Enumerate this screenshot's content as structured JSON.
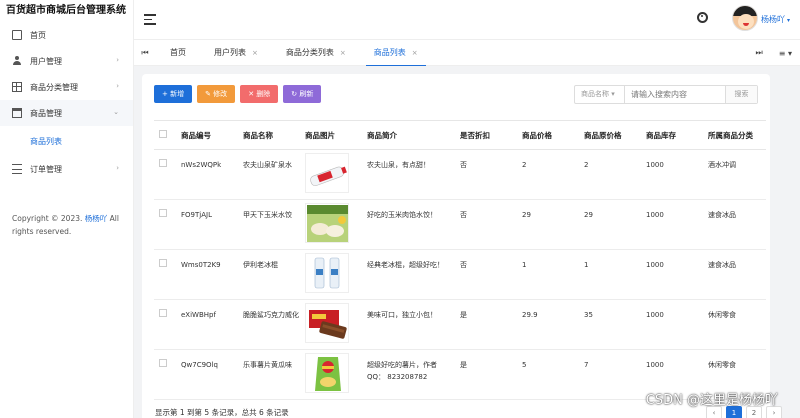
{
  "app": {
    "title": "百货超市商城后台管理系统"
  },
  "sidebar": {
    "items": [
      {
        "label": "首页",
        "icon": "home-icon"
      },
      {
        "label": "用户管理",
        "icon": "user-icon"
      },
      {
        "label": "商品分类管理",
        "icon": "grid-icon"
      },
      {
        "label": "商品管理",
        "icon": "shop-icon"
      },
      {
        "label": "商品列表"
      },
      {
        "label": "订单管理",
        "icon": "list-icon"
      }
    ],
    "copyright_prefix": "Copyright © 2023.",
    "copyright_name": "杨杨吖",
    "copyright_suffix": "All rights reserved."
  },
  "header": {
    "username": "杨杨吖"
  },
  "tabs": [
    {
      "label": "首页"
    },
    {
      "label": "用户列表"
    },
    {
      "label": "商品分类列表"
    },
    {
      "label": "商品列表"
    }
  ],
  "toolbar": {
    "add_label": "+ 新增",
    "edit_label": "✎ 修改",
    "delete_label": "✕ 删除",
    "refresh_label": "↻ 刷新"
  },
  "search": {
    "field_label": "商品名称",
    "placeholder": "请输入搜索内容",
    "button_label": "搜索"
  },
  "table": {
    "columns": [
      "商品编号",
      "商品名称",
      "商品图片",
      "商品简介",
      "是否折扣",
      "商品价格",
      "商品原价格",
      "商品库存",
      "所属商品分类"
    ],
    "rows": [
      {
        "code": "nWs2WQPk",
        "name": "农夫山泉矿泉水",
        "intro": "农夫山泉，有点甜！",
        "discount": "否",
        "price": "2",
        "original": "2",
        "stock": "1000",
        "category": "酒水冲调"
      },
      {
        "code": "FO9TjAJL",
        "name": "甲天下玉米水饺",
        "intro": "好吃的玉米肉馅水饺！",
        "discount": "否",
        "price": "29",
        "original": "29",
        "stock": "1000",
        "category": "速食冰品"
      },
      {
        "code": "Wms0T2K9",
        "name": "伊利老冰棍",
        "intro": "经典老冰棍，超级好吃！",
        "discount": "否",
        "price": "1",
        "original": "1",
        "stock": "1000",
        "category": "速食冰品"
      },
      {
        "code": "eXiWBHpf",
        "name": "脆脆鲨巧克力威化",
        "intro": "美味可口，独立小包！",
        "discount": "是",
        "price": "29.9",
        "original": "35",
        "stock": "1000",
        "category": "休闲零食"
      },
      {
        "code": "Qw7C9Olq",
        "name": "乐事薯片黄瓜味",
        "intro": "超级好吃的薯片，作者QQ： 823208782",
        "discount": "是",
        "price": "5",
        "original": "7",
        "stock": "1000",
        "category": "休闲零食"
      }
    ]
  },
  "pagination": {
    "summary": "显示第 1 到第 5 条记录，总共 6 条记录",
    "pages": [
      "‹",
      "1",
      "2",
      "›"
    ]
  },
  "watermark": "CSDN @这里是杨杨吖",
  "colors": {
    "primary": "#1e6fd9",
    "edit": "#f29a3b",
    "delete": "#f26c6c",
    "refresh": "#8e6ad8"
  }
}
